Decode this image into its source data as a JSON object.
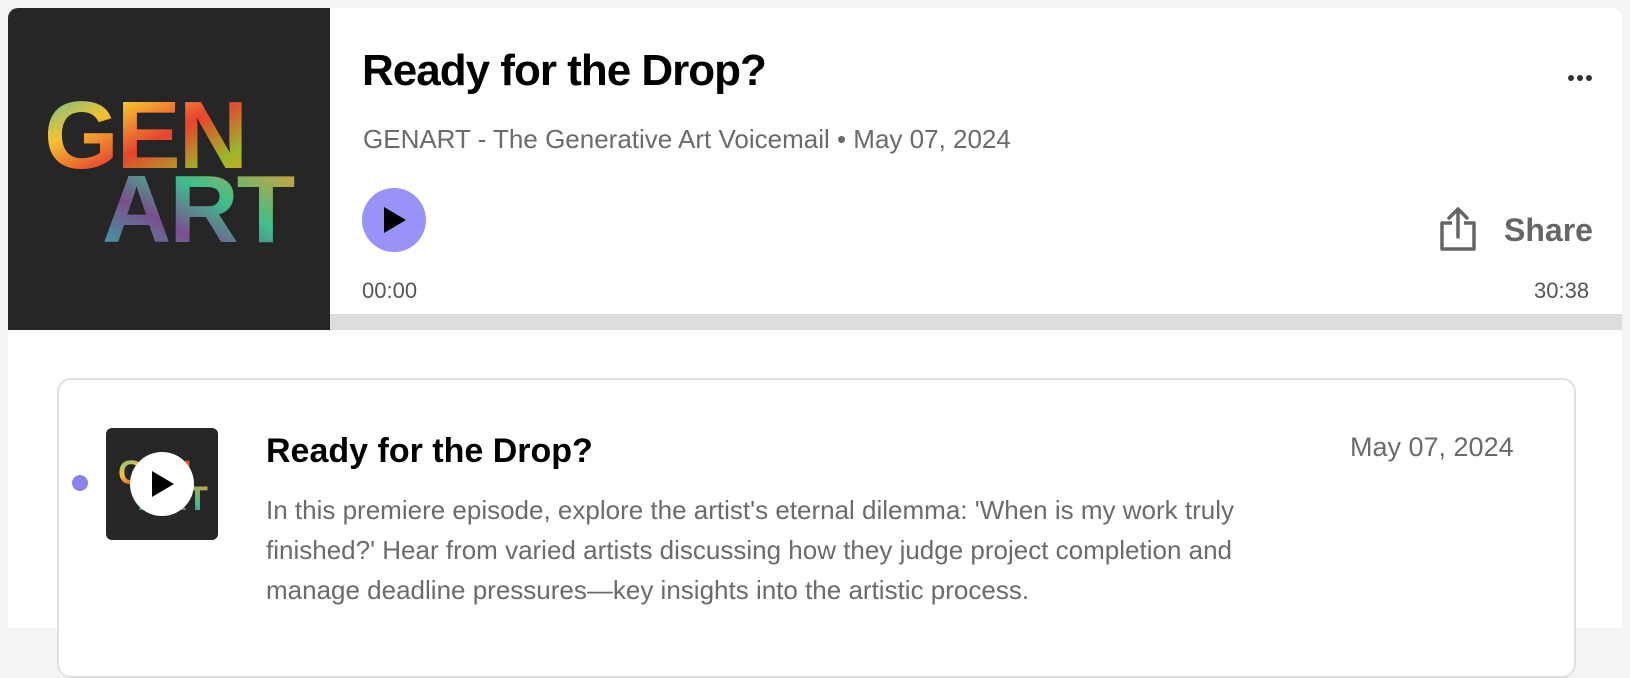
{
  "header": {
    "cover_alt": "GENART",
    "cover_line1": "GEN",
    "cover_line2": "ART",
    "title": "Ready for the Drop?",
    "meta": "GENART - The Generative Art Voicemail • May 07, 2024",
    "more_icon": "more-horizontal-icon",
    "play_icon": "play-icon",
    "share_icon": "share-upload-icon",
    "share_label": "Share",
    "time_elapsed": "00:00",
    "time_total": "30:38",
    "progress": 0,
    "accent_color": "#9993f7"
  },
  "episodes": [
    {
      "title": "Ready for the Drop?",
      "date": "May 07, 2024",
      "description": "In this premiere episode, explore the artist's eternal dilemma: 'When is my work truly finished?' Hear from varied artists discussing how they judge project completion and manage deadline pressures—key insights into the artistic process.",
      "unplayed_color": "#8a84f2",
      "play_icon": "play-icon"
    }
  ]
}
